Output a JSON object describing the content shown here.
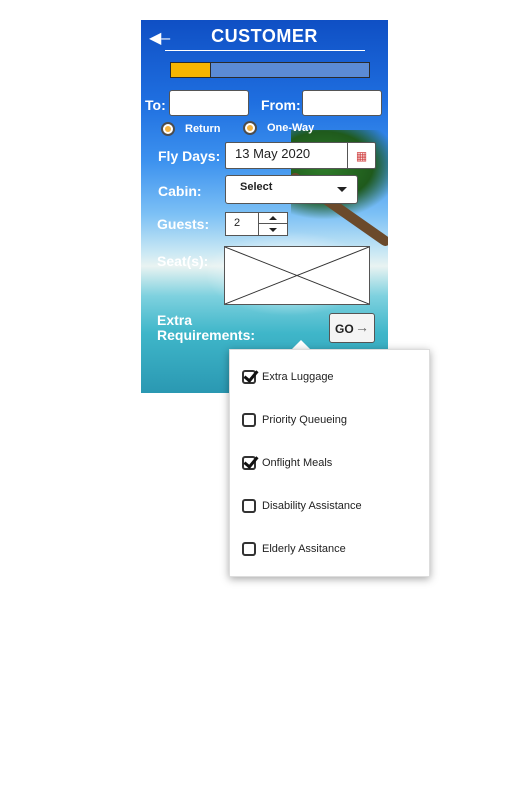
{
  "header": {
    "title": "CUSTOMER",
    "back_icon": "arrow-left-icon"
  },
  "progress": {
    "value": 0.2,
    "fill_color": "#f7b500",
    "track_color": "#5b8bd5"
  },
  "route": {
    "to_label": "To:",
    "to_value": "",
    "from_label": "From:",
    "from_value": ""
  },
  "trip_type": {
    "options": [
      "Return",
      "One-Way"
    ]
  },
  "fly_days": {
    "label": "Fly Days:",
    "value": "13 May 2020",
    "icon": "calendar-icon"
  },
  "cabin": {
    "label": "Cabin:",
    "selected": "Select"
  },
  "guests": {
    "label": "Guests:",
    "value": "2"
  },
  "seats": {
    "label": "Seat(s):"
  },
  "extra": {
    "label": "Extra Requirements:",
    "go_label": "GO",
    "go_icon": "arrow-right-icon"
  },
  "requirements": [
    {
      "label": "Extra Luggage",
      "checked": true
    },
    {
      "label": "Priority Queueing",
      "checked": false
    },
    {
      "label": "Onflight Meals",
      "checked": true
    },
    {
      "label": "Disability Assistance",
      "checked": false
    },
    {
      "label": "Elderly Assitance",
      "checked": false
    }
  ]
}
